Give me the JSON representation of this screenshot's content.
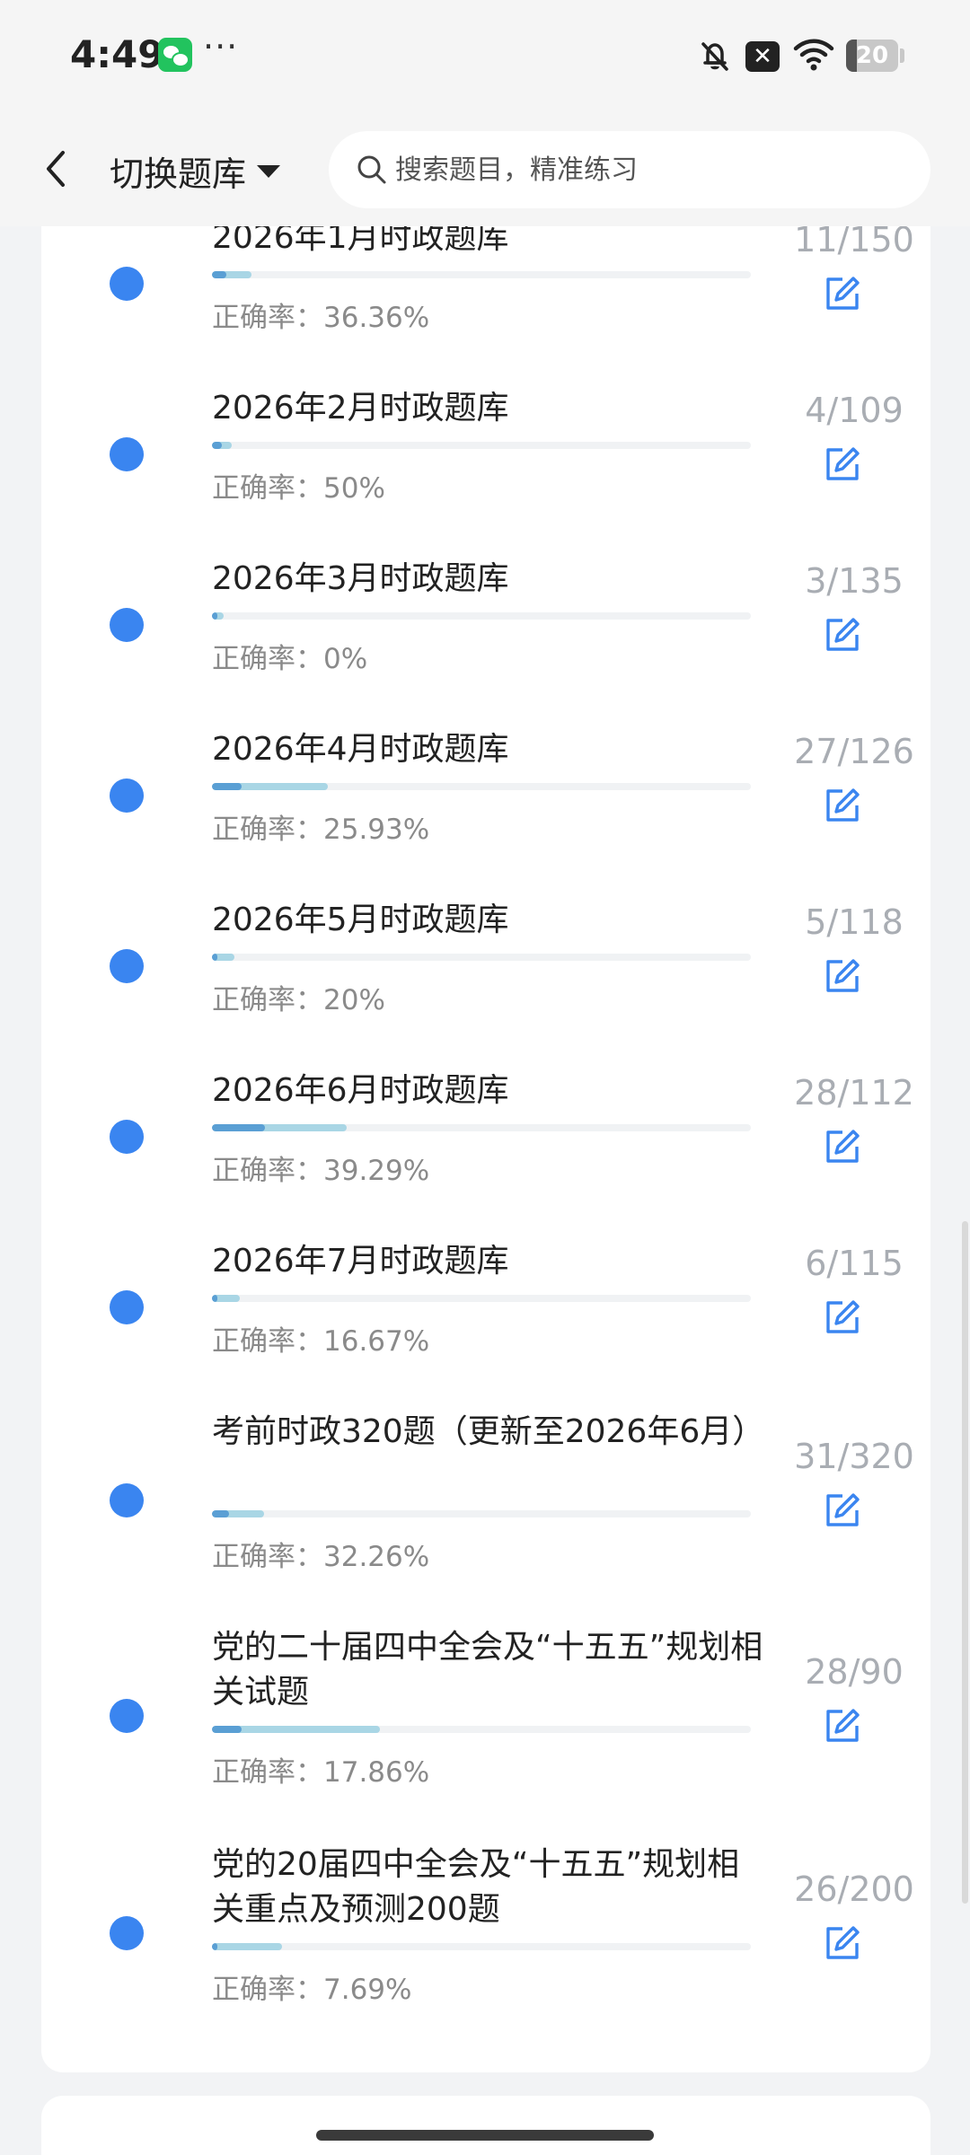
{
  "status_bar": {
    "time": "4:49",
    "battery_level": "20",
    "battery_fraction": 0.2
  },
  "header": {
    "switch_label": "切换题库",
    "search_placeholder": "搜索题目，精准练习"
  },
  "colors": {
    "accent_dot": "#3a85f0",
    "progress_done": "#a9d6e5",
    "progress_correct": "#5a9fd4",
    "edit_icon": "#3a85f0"
  },
  "items": [
    {
      "title": "2026年1月时政题库",
      "count": "11/150",
      "accuracy": "正确率：36.36%",
      "done": 11,
      "total": 150,
      "correct_rate": 0.3636
    },
    {
      "title": "2026年2月时政题库",
      "count": "4/109",
      "accuracy": "正确率：50%",
      "done": 4,
      "total": 109,
      "correct_rate": 0.5
    },
    {
      "title": "2026年3月时政题库",
      "count": "3/135",
      "accuracy": "正确率：0%",
      "done": 3,
      "total": 135,
      "correct_rate": 0
    },
    {
      "title": "2026年4月时政题库",
      "count": "27/126",
      "accuracy": "正确率：25.93%",
      "done": 27,
      "total": 126,
      "correct_rate": 0.2593
    },
    {
      "title": "2026年5月时政题库",
      "count": "5/118",
      "accuracy": "正确率：20%",
      "done": 5,
      "total": 118,
      "correct_rate": 0.2
    },
    {
      "title": "2026年6月时政题库",
      "count": "28/112",
      "accuracy": "正确率：39.29%",
      "done": 28,
      "total": 112,
      "correct_rate": 0.3929
    },
    {
      "title": "2026年7月时政题库",
      "count": "6/115",
      "accuracy": "正确率：16.67%",
      "done": 6,
      "total": 115,
      "correct_rate": 0.1667
    },
    {
      "title": "考前时政320题（更新至2026年6月）",
      "count": "31/320",
      "accuracy": "正确率：32.26%",
      "done": 31,
      "total": 320,
      "correct_rate": 0.3226
    },
    {
      "title": "党的二十届四中全会及“十五五”规划相关试题",
      "count": "28/90",
      "accuracy": "正确率：17.86%",
      "done": 28,
      "total": 90,
      "correct_rate": 0.1786
    },
    {
      "title": "党的20届四中全会及“十五五”规划相关重点及预测200题",
      "count": "26/200",
      "accuracy": "正确率：7.69%",
      "done": 26,
      "total": 200,
      "correct_rate": 0.0769
    }
  ]
}
